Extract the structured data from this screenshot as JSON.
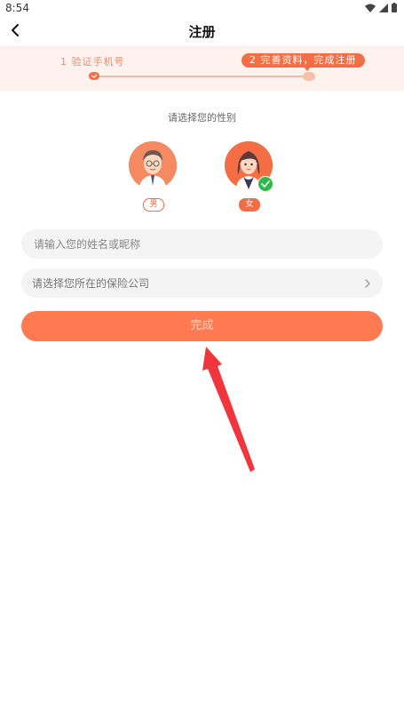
{
  "status_bar": {
    "time": "8:54"
  },
  "nav": {
    "title": "注册"
  },
  "steps": {
    "step1_label": "1  验证手机号",
    "step2_label": "2  完善资料，完成注册",
    "current_step": 2
  },
  "gender": {
    "prompt": "请选择您的性别",
    "male_label": "男",
    "female_label": "女",
    "selected": "female"
  },
  "form": {
    "name_placeholder": "请输入您的姓名或昵称",
    "company_placeholder": "请选择您所在的保险公司"
  },
  "submit": {
    "label": "完成"
  },
  "colors": {
    "accent": "#f46d44",
    "button": "#ff7a50",
    "arrow": "#f0353d",
    "check": "#2fb94b"
  }
}
